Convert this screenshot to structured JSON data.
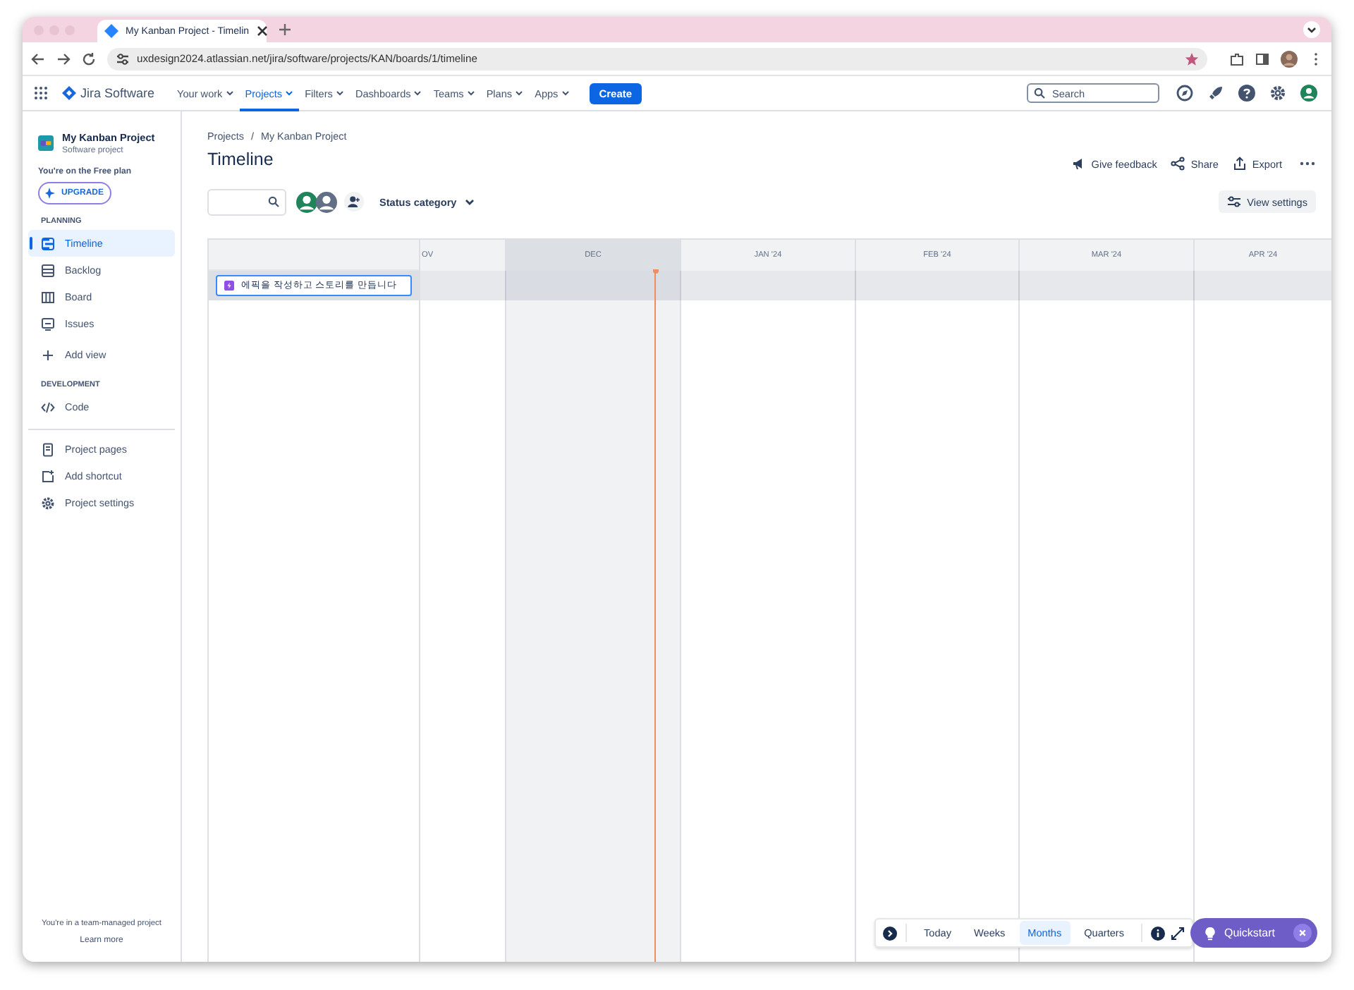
{
  "browser": {
    "tab_title": "My Kanban Project - Timelin",
    "url": "uxdesign2024.atlassian.net/jira/software/projects/KAN/boards/1/timeline"
  },
  "nav": {
    "product": "Jira Software",
    "items": [
      {
        "label": "Your work",
        "selected": false
      },
      {
        "label": "Projects",
        "selected": true
      },
      {
        "label": "Filters",
        "selected": false
      },
      {
        "label": "Dashboards",
        "selected": false
      },
      {
        "label": "Teams",
        "selected": false
      },
      {
        "label": "Plans",
        "selected": false
      },
      {
        "label": "Apps",
        "selected": false
      }
    ],
    "create": "Create",
    "search": {
      "placeholder": "Search"
    }
  },
  "sidebar": {
    "project": "My Kanban Project",
    "project_type": "Software project",
    "plan": "You're on the Free plan",
    "upgrade": "UPGRADE",
    "groups": [
      {
        "heading": "PLANNING",
        "items": [
          {
            "label": "Timeline",
            "selected": true
          },
          {
            "label": "Backlog",
            "selected": false
          },
          {
            "label": "Board",
            "selected": false
          },
          {
            "label": "Issues",
            "selected": false
          },
          {
            "label": "Add view",
            "selected": false
          }
        ]
      },
      {
        "heading": "DEVELOPMENT",
        "items": [
          {
            "label": "Code",
            "selected": false
          }
        ]
      },
      {
        "items": [
          {
            "label": "Project pages",
            "selected": false
          },
          {
            "label": "Add shortcut",
            "selected": false
          },
          {
            "label": "Project settings",
            "selected": false
          }
        ]
      }
    ],
    "footer": "You're in a team-managed project",
    "learn_more": "Learn more"
  },
  "page": {
    "breadcrumbs": [
      "Projects",
      "My Kanban Project"
    ],
    "breadcrumb_separator": "/",
    "title": "Timeline",
    "actions": [
      "Give feedback",
      "Share",
      "Export"
    ],
    "filter": {
      "label": "Status category"
    },
    "view_settings": "View settings"
  },
  "timeline": {
    "months": [
      {
        "label": "OV",
        "current": false
      },
      {
        "label": "DEC",
        "current": true
      },
      {
        "label": "JAN '24",
        "current": false
      },
      {
        "label": "FEB '24",
        "current": false
      },
      {
        "label": "MAR '24",
        "current": false
      },
      {
        "label": "APR '24",
        "current": false
      }
    ],
    "rows": [
      {
        "summary": "에픽을 작성하고 스토리를 만듭니다",
        "selected": true
      }
    ],
    "zoom": [
      {
        "label": "Today",
        "selected": false
      },
      {
        "label": "Weeks",
        "selected": false
      },
      {
        "label": "Months",
        "selected": true
      },
      {
        "label": "Quarters",
        "selected": false
      }
    ]
  },
  "quickstart": "Quickstart"
}
